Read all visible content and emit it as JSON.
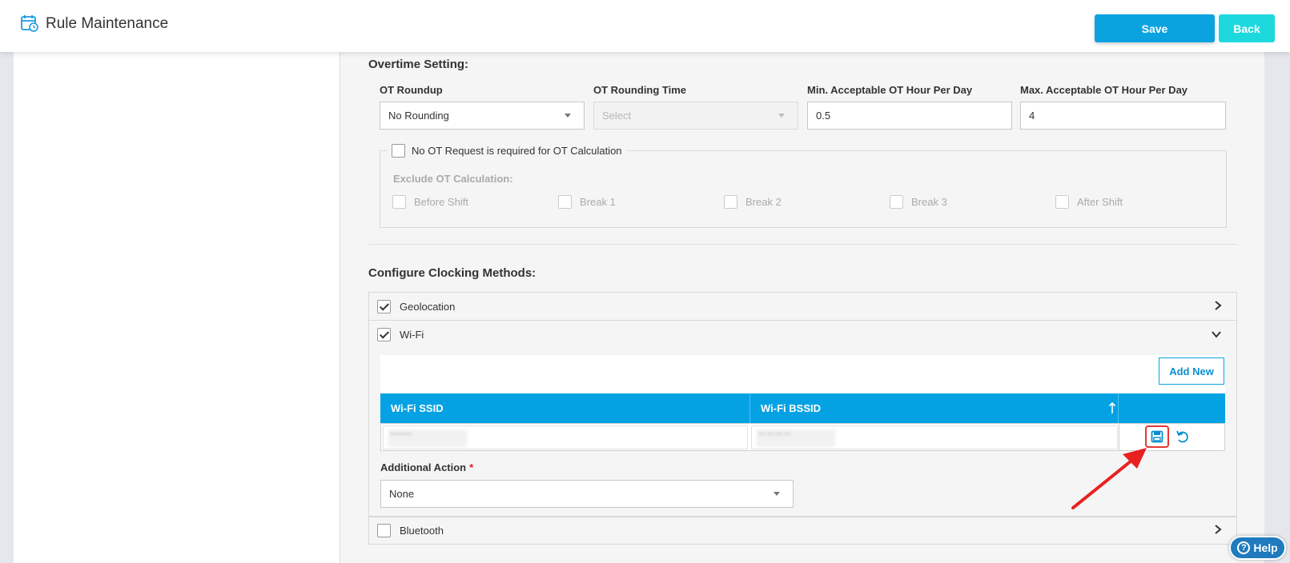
{
  "header": {
    "title": "Rule Maintenance",
    "save_label": "Save",
    "back_label": "Back"
  },
  "overtime": {
    "section_title": "Overtime Setting:",
    "ot_roundup": {
      "label": "OT Roundup",
      "value": "No Rounding"
    },
    "ot_rounding_time": {
      "label": "OT Rounding Time",
      "placeholder": "Select"
    },
    "min_ot": {
      "label": "Min. Acceptable OT Hour Per Day",
      "value": "0.5"
    },
    "max_ot": {
      "label": "Max. Acceptable OT Hour Per Day",
      "value": "4"
    },
    "no_ot_request": {
      "label": "No OT Request is required for OT Calculation",
      "checked": false
    },
    "exclude_label": "Exclude OT Calculation:",
    "exclude_items": [
      {
        "label": "Before Shift",
        "checked": false
      },
      {
        "label": "Break 1",
        "checked": false
      },
      {
        "label": "Break 2",
        "checked": false
      },
      {
        "label": "Break 3",
        "checked": false
      },
      {
        "label": "After Shift",
        "checked": false
      }
    ]
  },
  "clocking": {
    "section_title": "Configure Clocking Methods:",
    "methods": [
      {
        "label": "Geolocation",
        "checked": true,
        "expanded": false
      },
      {
        "label": "Wi-Fi",
        "checked": true,
        "expanded": true
      },
      {
        "label": "Bluetooth",
        "checked": false,
        "expanded": false
      }
    ],
    "wifi": {
      "add_new_label": "Add New",
      "columns": [
        "Wi-Fi SSID",
        "Wi-Fi BSSID",
        ""
      ],
      "row": {
        "ssid": "•••••••",
        "bssid": "••:••:••:••"
      },
      "additional_action": {
        "label": "Additional Action",
        "required_mark": "*",
        "value": "None"
      }
    }
  },
  "help": {
    "label": "Help"
  },
  "colors": {
    "primary": "#0aa3e0",
    "back_button": "#1dd9de",
    "grid_header": "#04a2e3",
    "highlight": "#e53935",
    "help_button": "#1f7bbd"
  },
  "icons": {
    "app": "calendar-clock-icon",
    "sort": "sort-ascending-icon",
    "row_save": "save-icon",
    "row_cancel": "undo-icon",
    "expand": "chevron-right-icon",
    "collapse": "chevron-down-icon",
    "help": "question-circle-icon"
  }
}
